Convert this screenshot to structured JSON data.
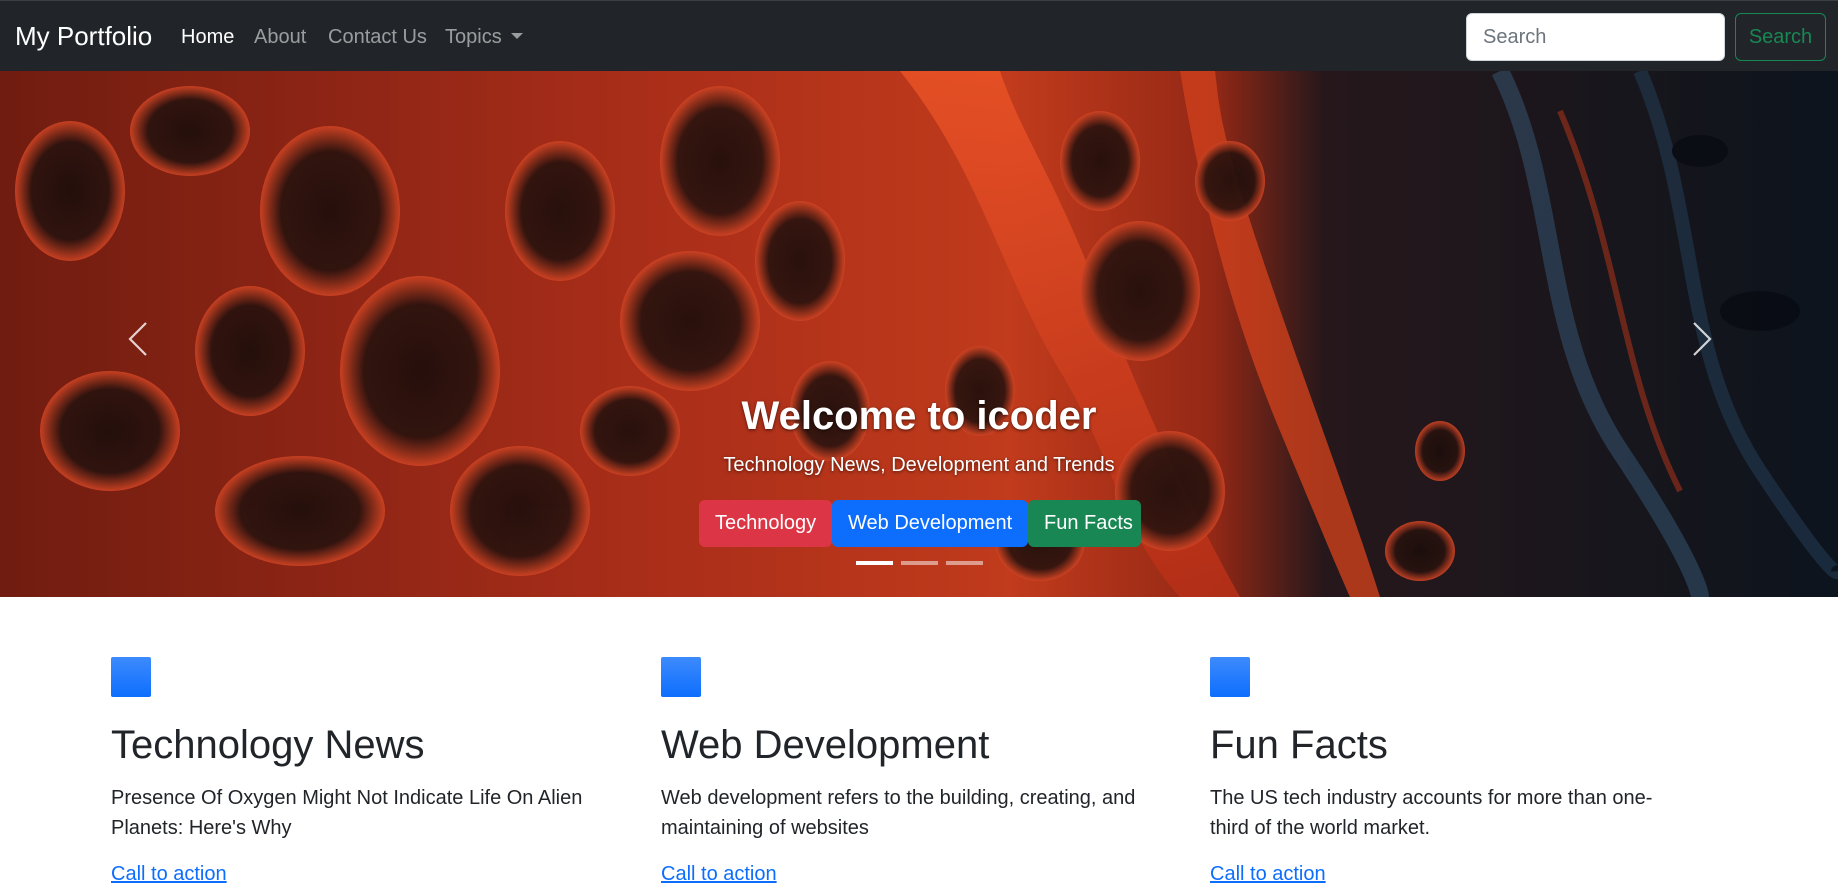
{
  "navbar": {
    "brand": "My Portfolio",
    "links": [
      {
        "label": "Home",
        "active": true
      },
      {
        "label": "About",
        "active": false
      },
      {
        "label": "Contact Us",
        "active": false
      },
      {
        "label": "Topics",
        "active": false,
        "dropdown": true
      }
    ],
    "search": {
      "placeholder": "Search",
      "value": "",
      "button_label": "Search"
    }
  },
  "hero": {
    "title": "Welcome to icoder",
    "subtitle": "Technology News, Development and Trends",
    "buttons": [
      {
        "label": "Technology",
        "color": "#dc3545"
      },
      {
        "label": "Web Development",
        "color": "#0d6efd"
      },
      {
        "label": "Fun Facts",
        "color": "#198754"
      }
    ],
    "slide_count": 3,
    "active_slide": 1,
    "prev_icon": "chevron-left-icon",
    "next_icon": "chevron-right-icon"
  },
  "features": [
    {
      "title": "Technology News",
      "text": "Presence Of Oxygen Might Not Indicate Life On Alien Planets: Here's Why",
      "link": "Call to action"
    },
    {
      "title": "Web Development",
      "text": "Web development refers to the building, creating, and maintaining of websites",
      "link": "Call to action"
    },
    {
      "title": "Fun Facts",
      "text": "The US tech industry accounts for more than one-third of the world market.",
      "link": "Call to action"
    }
  ],
  "colors": {
    "navbar_bg": "#212529",
    "primary": "#0d6efd",
    "danger": "#dc3545",
    "success": "#198754"
  }
}
